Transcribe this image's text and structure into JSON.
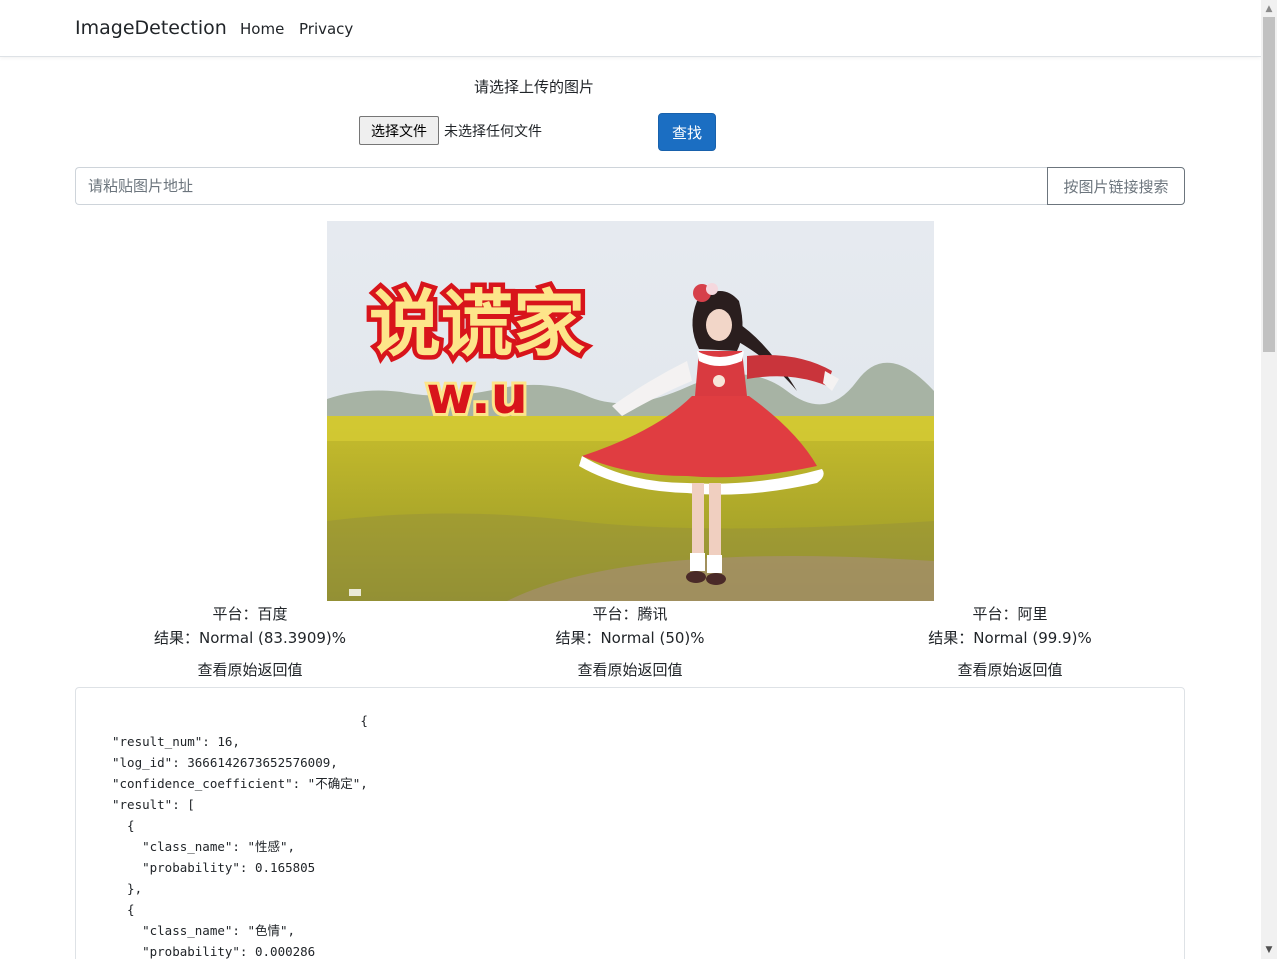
{
  "navbar": {
    "brand": "ImageDetection",
    "links": [
      "Home",
      "Privacy"
    ]
  },
  "upload": {
    "title": "请选择上传的图片",
    "file_button": "选择文件",
    "file_status": "未选择任何文件",
    "find_button": "查找"
  },
  "url_search": {
    "placeholder": "请粘贴图片地址",
    "button": "按图片链接搜索"
  },
  "image": {
    "overlay_title": "说谎家",
    "overlay_subtitle": "w.u"
  },
  "results": [
    {
      "platform_label": "平台：",
      "platform": "百度",
      "result_label": "结果：",
      "result": "Normal (83.3909)%",
      "raw_link": "查看原始返回值"
    },
    {
      "platform_label": "平台：",
      "platform": "腾讯",
      "result_label": "结果：",
      "result": "Normal (50)%",
      "raw_link": "查看原始返回值"
    },
    {
      "platform_label": "平台：",
      "platform": "阿里",
      "result_label": "结果：",
      "result": "Normal (99.9)%",
      "raw_link": "查看原始返回值"
    }
  ],
  "raw_json": "                                 {\n\"result_num\": 16,\n\"log_id\": 3666142673652576009,\n\"confidence_coefficient\": \"不确定\",\n\"result\": [\n  {\n    \"class_name\": \"性感\",\n    \"probability\": 0.165805\n  },\n  {\n    \"class_name\": \"色情\",\n    \"probability\": 0.000286",
  "colors": {
    "primary": "#1b6ec2",
    "border": "#dee2e6",
    "text": "#212529",
    "muted": "#6c757d"
  }
}
